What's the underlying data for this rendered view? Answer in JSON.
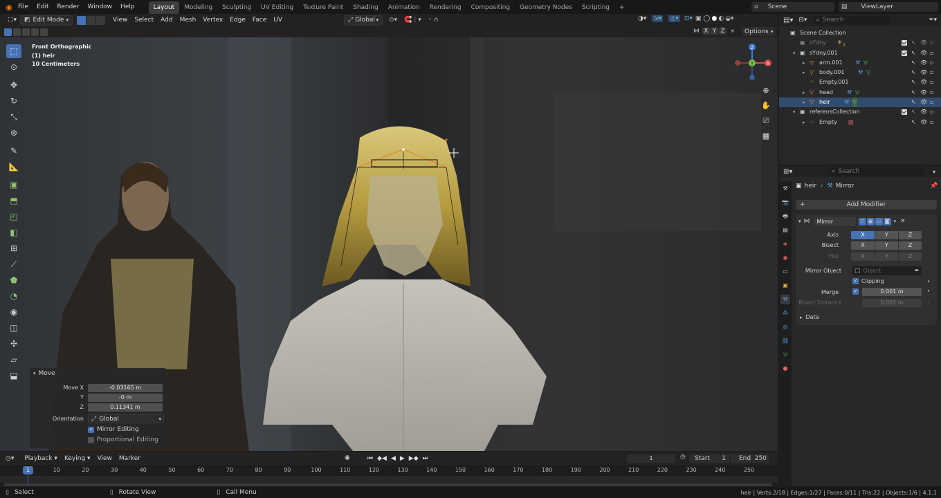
{
  "menu": {
    "items": [
      "File",
      "Edit",
      "Render",
      "Window",
      "Help"
    ],
    "workspaces": [
      "Layout",
      "Modeling",
      "Sculpting",
      "UV Editing",
      "Texture Paint",
      "Shading",
      "Animation",
      "Rendering",
      "Compositing",
      "Geometry Nodes",
      "Scripting"
    ],
    "active_workspace": "Layout",
    "add_tab": "+",
    "scene": "Scene",
    "view_layer": "ViewLayer"
  },
  "viewport_header": {
    "mode": "Edit Mode",
    "menus": [
      "View",
      "Select",
      "Add",
      "Mesh",
      "Vertex",
      "Edge",
      "Face",
      "UV"
    ],
    "orientation": "Global",
    "axes": [
      "X",
      "Y",
      "Z"
    ],
    "options": "Options"
  },
  "viewport": {
    "view_name": "Front Orthographic",
    "object_name": "(1) heir",
    "scale": "10 Centimeters"
  },
  "outliner": {
    "search_placeholder": "Search",
    "rows": [
      {
        "label": "Scene Collection",
        "indent": 0
      },
      {
        "label": "sYdny",
        "indent": 1,
        "dim": true,
        "badge": "2"
      },
      {
        "label": "sYdny.001",
        "indent": 1
      },
      {
        "label": "arm.001",
        "indent": 2
      },
      {
        "label": "body.001",
        "indent": 2
      },
      {
        "label": "Empty.001",
        "indent": 2
      },
      {
        "label": "head",
        "indent": 2
      },
      {
        "label": "heir",
        "indent": 2
      },
      {
        "label": "referensCollection",
        "indent": 1
      },
      {
        "label": "Empty",
        "indent": 2
      }
    ]
  },
  "properties": {
    "search_placeholder": "Search",
    "breadcrumb_object": "heir",
    "breadcrumb_modifier": "Mirror",
    "add_modifier": "Add Modifier",
    "modifier_name": "Mirror",
    "axis_label": "Axis",
    "bisect_label": "Bisect",
    "flip_label": "Flip",
    "xyz": [
      "X",
      "Y",
      "Z"
    ],
    "mirror_object_label": "Mirror Object",
    "mirror_object_placeholder": "Object",
    "clipping_label": "Clipping",
    "merge_label": "Merge",
    "merge_value": "0.001 m",
    "bisect_distance_label": "Bisect Distance",
    "bisect_distance_value": "0.001 m",
    "data_label": "Data"
  },
  "move_panel": {
    "title": "Move",
    "move_x_label": "Move X",
    "move_x": "-0.03165 m",
    "y_label": "Y",
    "y": "-0 m",
    "z_label": "Z",
    "z": "0.11341 m",
    "orientation_label": "Orientation",
    "orientation": "Global",
    "mirror_editing": "Mirror Editing",
    "proportional_editing": "Proportional Editing"
  },
  "timeline": {
    "menus": [
      "Playback",
      "Keying",
      "View",
      "Marker"
    ],
    "current_frame": "1",
    "start_label": "Start",
    "start": "1",
    "end_label": "End",
    "end": "250",
    "ticks": [
      "10",
      "20",
      "30",
      "40",
      "50",
      "60",
      "70",
      "80",
      "90",
      "100",
      "110",
      "120",
      "130",
      "140",
      "150",
      "160",
      "170",
      "180",
      "190",
      "200",
      "210",
      "220",
      "230",
      "240",
      "250"
    ],
    "playhead": "1"
  },
  "statusbar": {
    "select": "Select",
    "rotate_view": "Rotate View",
    "call_menu": "Call Menu",
    "stats": "heir | Verts:2/18 | Edges:1/27 | Faces:0/11 | Tris:22 | Objects:1/6 | 4.1.1"
  },
  "colors": {
    "accent": "#4772b3",
    "bg": "#1d1d1d",
    "panel": "#282828"
  }
}
